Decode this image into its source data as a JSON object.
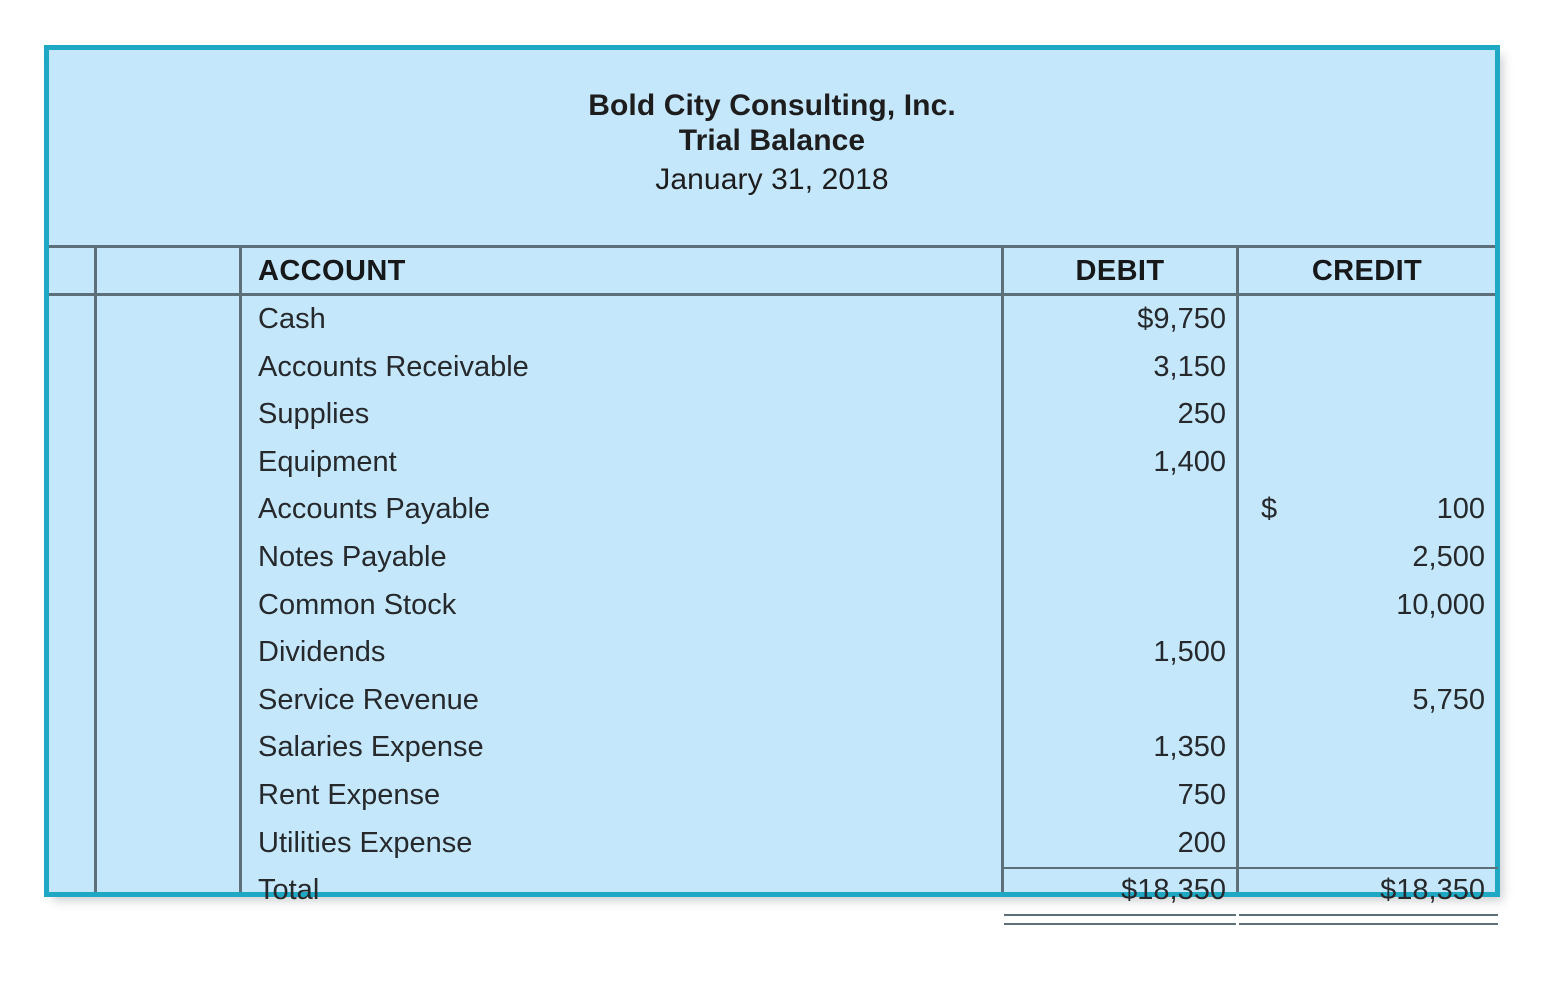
{
  "document": {
    "company": "Bold City Consulting, Inc.",
    "statement": "Trial Balance",
    "date": "January 31, 2018"
  },
  "table": {
    "headers": {
      "account": "ACCOUNT",
      "debit": "DEBIT",
      "credit": "CREDIT"
    },
    "rows": [
      {
        "account": "Cash",
        "debit": "$9,750",
        "credit": ""
      },
      {
        "account": "Accounts Receivable",
        "debit": "3,150",
        "credit": ""
      },
      {
        "account": "Supplies",
        "debit": "250",
        "credit": ""
      },
      {
        "account": "Equipment",
        "debit": "1,400",
        "credit": ""
      },
      {
        "account": "Accounts Payable",
        "debit": "",
        "credit": "100",
        "credit_symbol": "$"
      },
      {
        "account": "Notes Payable",
        "debit": "",
        "credit": "2,500"
      },
      {
        "account": "Common Stock",
        "debit": "",
        "credit": "10,000"
      },
      {
        "account": "Dividends",
        "debit": "1,500",
        "credit": ""
      },
      {
        "account": "Service Revenue",
        "debit": "",
        "credit": "5,750"
      },
      {
        "account": "Salaries Expense",
        "debit": "1,350",
        "credit": ""
      },
      {
        "account": "Rent Expense",
        "debit": "750",
        "credit": ""
      },
      {
        "account": "Utilities Expense",
        "debit": "200",
        "credit": ""
      }
    ],
    "total": {
      "account": "Total",
      "debit": "$18,350",
      "credit": "$18,350"
    }
  },
  "colors": {
    "frame": "#1fa8c4",
    "fill": "#c5e7fb",
    "rule": "#5d6f78",
    "text": "#26292b"
  }
}
